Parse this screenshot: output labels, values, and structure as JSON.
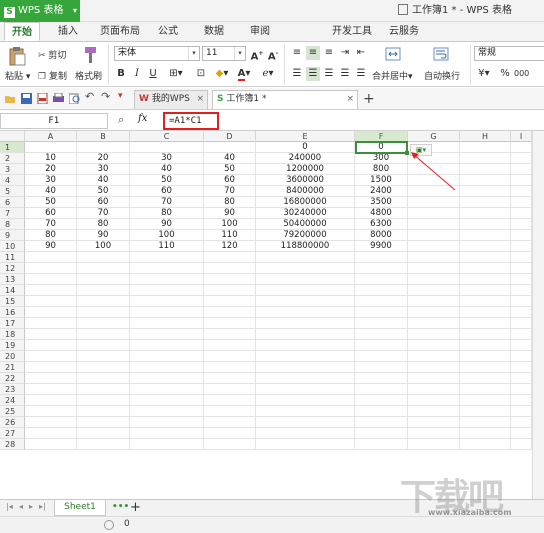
{
  "app": {
    "menu_button": "WPS 表格",
    "window_title": "工作簿1 * - WPS 表格"
  },
  "ribbon_tabs": [
    "开始",
    "插入",
    "页面布局",
    "公式",
    "数据",
    "审阅",
    "开发工具",
    "云服务"
  ],
  "ribbon": {
    "paste": "粘贴",
    "cut": "剪切",
    "copy": "复制",
    "format_painter": "格式刷",
    "font_name": "宋体",
    "font_size": "11",
    "bold": "B",
    "italic": "I",
    "underline": "U",
    "merge_center": "合并居中",
    "wrap_text": "自动换行",
    "number_format": "常规",
    "percent": "%"
  },
  "doc_tabs": {
    "my_wps": "我的WPS",
    "workbook": "工作簿1 *"
  },
  "formula_bar": {
    "cell_ref": "F1",
    "fx": "fx",
    "formula": "=A1*C1"
  },
  "columns": [
    "A",
    "B",
    "C",
    "D",
    "E",
    "F",
    "G",
    "H",
    "I"
  ],
  "row_numbers": [
    "1",
    "2",
    "3",
    "4",
    "5",
    "6",
    "7",
    "8",
    "9",
    "10",
    "11",
    "12",
    "13",
    "14",
    "15",
    "16",
    "17",
    "18",
    "19",
    "20",
    "21",
    "22",
    "23",
    "24",
    "25",
    "26",
    "27",
    "28"
  ],
  "rows": [
    [
      "",
      "",
      "",
      "",
      "0",
      "0"
    ],
    [
      "10",
      "20",
      "30",
      "40",
      "240000",
      "300"
    ],
    [
      "20",
      "30",
      "40",
      "50",
      "1200000",
      "800"
    ],
    [
      "30",
      "40",
      "50",
      "60",
      "3600000",
      "1500"
    ],
    [
      "40",
      "50",
      "60",
      "70",
      "8400000",
      "2400"
    ],
    [
      "50",
      "60",
      "70",
      "80",
      "16800000",
      "3500"
    ],
    [
      "60",
      "70",
      "80",
      "90",
      "30240000",
      "4800"
    ],
    [
      "70",
      "80",
      "90",
      "100",
      "50400000",
      "6300"
    ],
    [
      "80",
      "90",
      "100",
      "110",
      "79200000",
      "8000"
    ],
    [
      "90",
      "100",
      "110",
      "120",
      "118800000",
      "9900"
    ]
  ],
  "sheet_tabs": [
    "Sheet1"
  ],
  "sheet_more": "•••",
  "add_sheet": "+",
  "status": {
    "value": "0"
  },
  "watermark": {
    "text": "下载吧",
    "url": "www.xiazaiba.com"
  },
  "colors": {
    "brand_green": "#36a63a",
    "selection_green": "#3e8e3e",
    "highlight_red": "#e02020"
  }
}
